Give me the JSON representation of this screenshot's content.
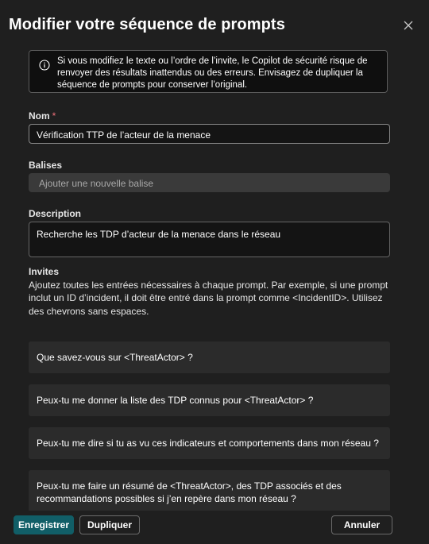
{
  "dialog": {
    "title": "Modifier votre séquence de prompts",
    "close_icon": "close-icon"
  },
  "info": {
    "icon": "info-icon",
    "text": "Si vous modifiez le texte ou l’ordre de l’invite, le Copilot de sécurité risque de renvoyer des résultats inattendus ou des erreurs. Envisagez de dupliquer la séquence de prompts pour conserver l’original."
  },
  "name": {
    "label": "Nom",
    "required_mark": "*",
    "value": "Vérification TTP de l’acteur de la menace"
  },
  "tags": {
    "label": "Balises",
    "placeholder": "Ajouter une nouvelle balise"
  },
  "description": {
    "label": "Description",
    "value": "Recherche les TDP d’acteur de la menace dans le réseau"
  },
  "prompts": {
    "label": "Invites",
    "help": "Ajoutez toutes les entrées nécessaires à chaque prompt. Par exemple, si une prompt inclut un ID d’incident, il doit être entré dans la prompt comme <IncidentID>. Utilisez des chevrons sans espaces.",
    "items": [
      "Que savez-vous sur <ThreatActor> ?",
      "Peux-tu me donner la liste des TDP connus pour <ThreatActor> ?",
      "Peux-tu me dire si tu as vu ces indicateurs et comportements dans mon réseau ?",
      "Peux-tu me faire un résumé de <ThreatActor>, des TDP associés et des recommandations possibles si j’en repère dans mon réseau ?"
    ]
  },
  "footer": {
    "save_label": "Enregistrer",
    "duplicate_label": "Dupliquer",
    "cancel_label": "Annuler"
  },
  "colors": {
    "background": "#1f1f1f",
    "primary": "#115e67",
    "required": "#f1707b"
  }
}
